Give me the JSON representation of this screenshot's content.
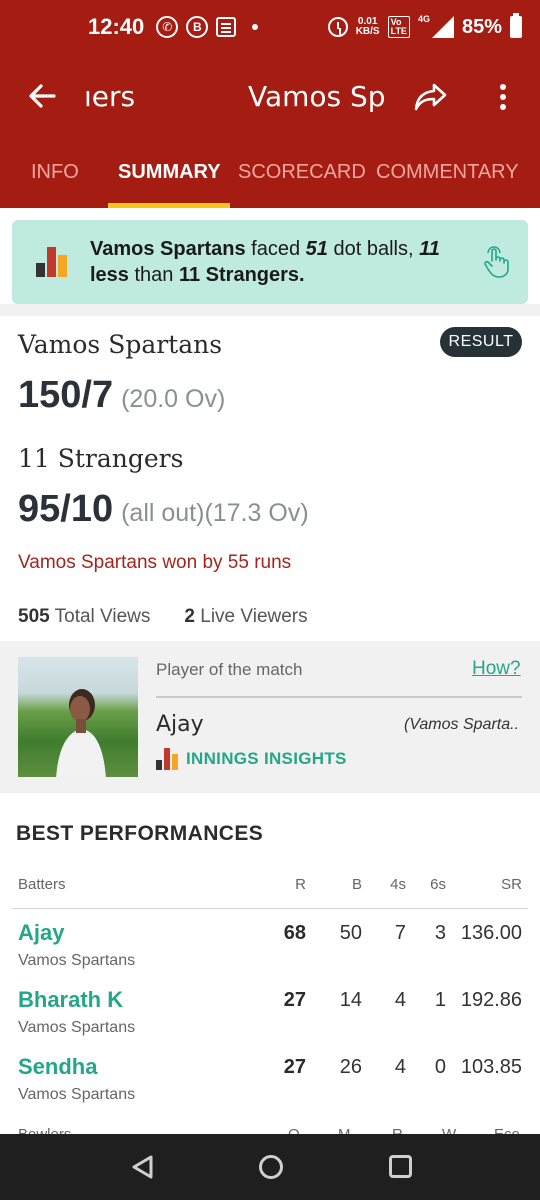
{
  "status_bar": {
    "time": "12:40",
    "data_rate_value": "0.01",
    "data_rate_unit": "KB/S",
    "network": "4G",
    "volte": "Vo LTE 1",
    "battery": "85%",
    "icons": [
      "whatsapp-icon",
      "b-icon",
      "news-icon",
      "dot-icon",
      "alarm-icon",
      "volte-icon",
      "signal-icon",
      "battery-icon"
    ]
  },
  "app_bar": {
    "prev_title_fragment": "ıers",
    "title": "Vamos Sp",
    "icons": [
      "back-arrow-icon",
      "share-icon",
      "more-vert-icon"
    ]
  },
  "tabs": [
    {
      "label": "INFO",
      "active": false
    },
    {
      "label": "SUMMARY",
      "active": true
    },
    {
      "label": "SCORECARD",
      "active": false
    },
    {
      "label": "COMMENTARY",
      "active": false
    }
  ],
  "insight": {
    "team": "Vamos Spartans",
    "text_1": " faced ",
    "dot_balls": "51",
    "text_2": " dot balls, ",
    "less_count": "11",
    "text_3": "less",
    "text_4": " than ",
    "opponent": "11 Strangers.",
    "colors": {
      "bar_dark": "#333333",
      "bar_red": "#c0392b",
      "bar_yellow": "#f5a623"
    }
  },
  "match": {
    "result_badge": "RESULT",
    "team1": {
      "name": "Vamos Spartans",
      "score": "150/7",
      "overs": "(20.0 Ov)"
    },
    "team2": {
      "name": "11 Strangers",
      "score": "95/10",
      "overs": "(all out)(17.3 Ov)"
    },
    "result": "Vamos Spartans won by 55 runs",
    "total_views": "505",
    "total_views_label": "Total Views",
    "live_viewers": "2",
    "live_viewers_label": "Live Viewers"
  },
  "player_of_match": {
    "label": "Player of the match",
    "how_link": "How?",
    "name": "Ajay",
    "team": "(Vamos Sparta..",
    "insights_label": "INNINGS INSIGHTS"
  },
  "best_performances": {
    "title": "BEST PERFORMANCES",
    "batters_header": {
      "label": "Batters",
      "r": "R",
      "b": "B",
      "fours": "4s",
      "sixes": "6s",
      "sr": "SR"
    },
    "batters": [
      {
        "name": "Ajay",
        "team": "Vamos Spartans",
        "r": "68",
        "b": "50",
        "fours": "7",
        "sixes": "3",
        "sr": "136.00"
      },
      {
        "name": "Bharath K",
        "team": "Vamos Spartans",
        "r": "27",
        "b": "14",
        "fours": "4",
        "sixes": "1",
        "sr": "192.86"
      },
      {
        "name": "Sendha",
        "team": "Vamos Spartans",
        "r": "27",
        "b": "26",
        "fours": "4",
        "sixes": "0",
        "sr": "103.85"
      }
    ],
    "bowlers_header": {
      "label": "Bowlers",
      "o": "O",
      "m": "M",
      "r": "R",
      "w": "W",
      "eco": "Eco"
    }
  },
  "nav_bar": {
    "icons": [
      "nav-back-icon",
      "nav-home-icon",
      "nav-recents-icon"
    ]
  },
  "colors": {
    "primary": "#a51d12",
    "accent": "#23a786",
    "tab_indicator": "#f5c518",
    "insight_bg": "#bfeadf"
  }
}
